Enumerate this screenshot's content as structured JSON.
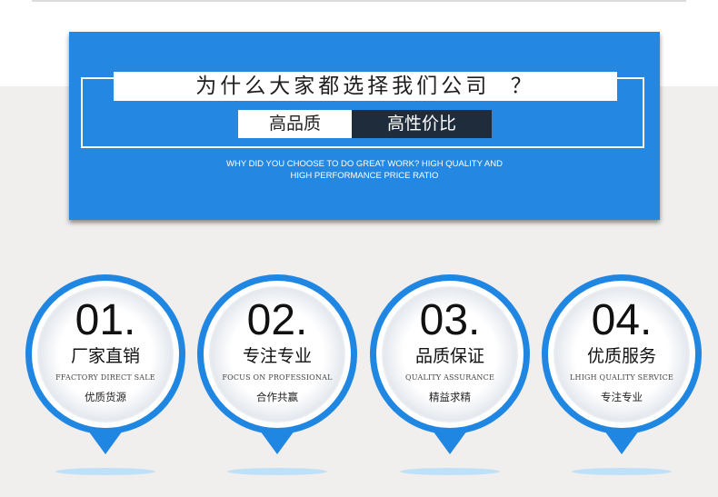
{
  "banner": {
    "title": "为什么大家都选择我们公司  ？",
    "tag_left": "高品质",
    "tag_right": "高性价比",
    "subtitle_line1": "WHY DID YOU CHOOSE TO DO GREAT WORK? HIGH QUALITY AND",
    "subtitle_line2": "HIGH PERFORMANCE PRICE RATIO"
  },
  "features": [
    {
      "number": "01.",
      "title": "厂家直销",
      "english": "FFACTORY DIRECT SALE",
      "subtitle": "优质货源"
    },
    {
      "number": "02.",
      "title": "专注专业",
      "english": "FOCUS ON PROFESSIONAL",
      "subtitle": "合作共赢"
    },
    {
      "number": "03.",
      "title": "品质保证",
      "english": "QUALITY ASSURANCE",
      "subtitle": "精益求精"
    },
    {
      "number": "04.",
      "title": "优质服务",
      "english": "LHIGH QUALITY SERVICE",
      "subtitle": "专注专业"
    }
  ],
  "colors": {
    "accent_blue": "#2488e2",
    "ring_blue": "#1f86e2",
    "background": "#f1eeee",
    "dark_tag": "#1f2c3b"
  }
}
